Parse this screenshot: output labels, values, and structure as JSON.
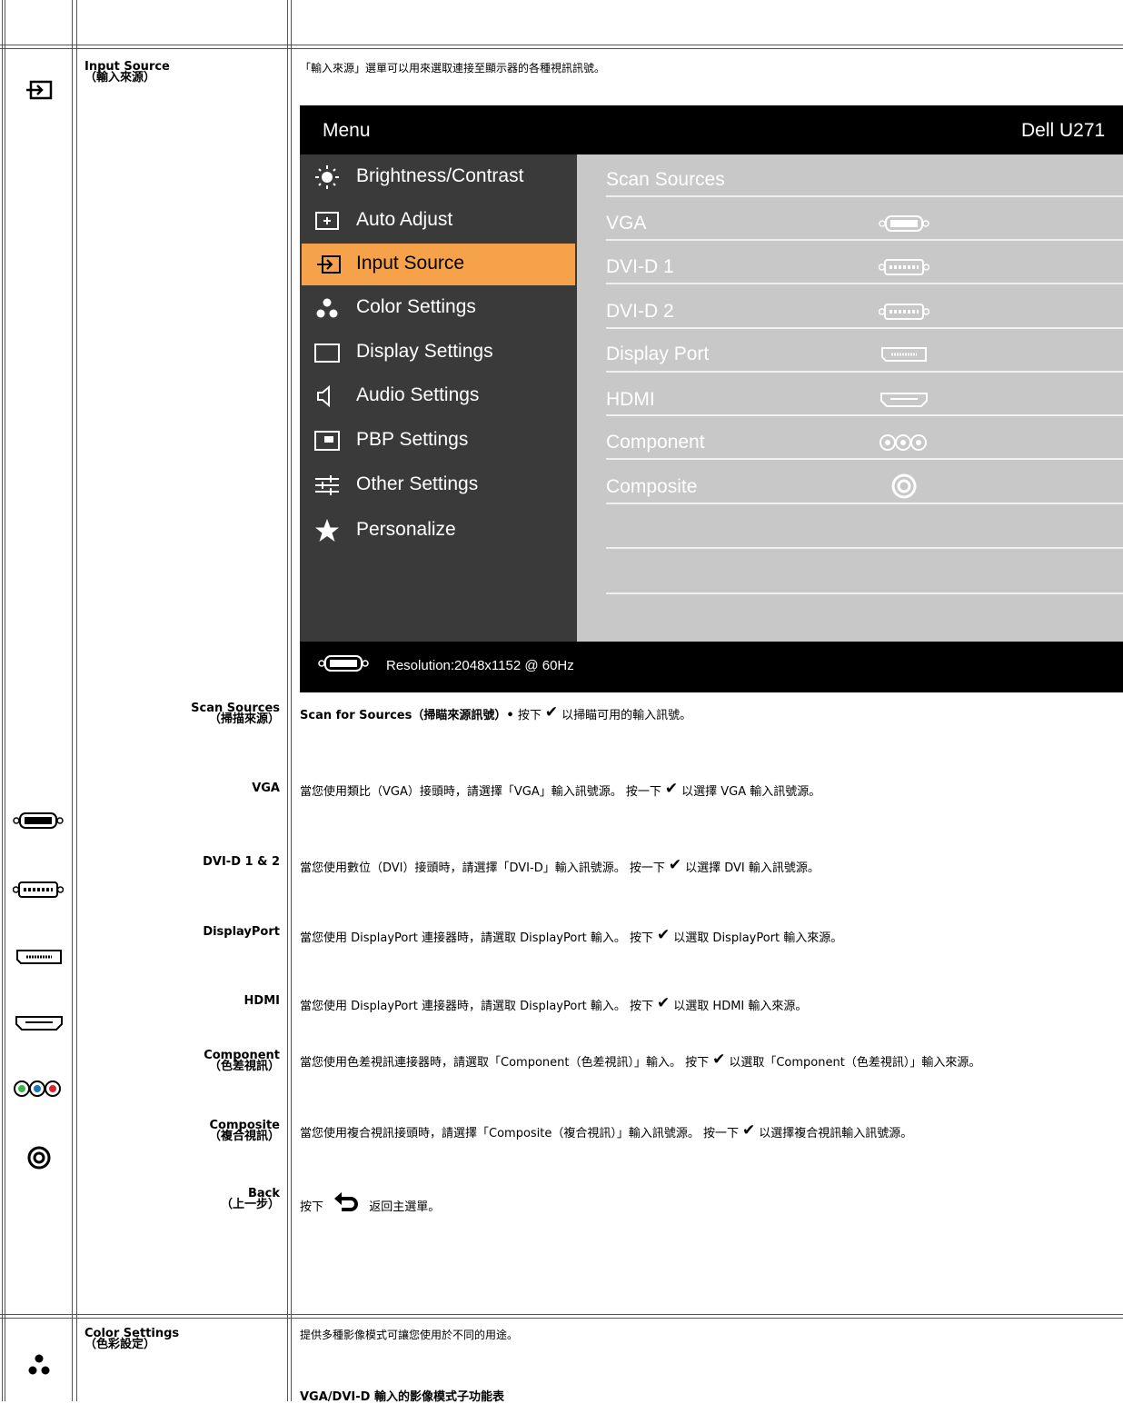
{
  "input_source": {
    "label_en": "Input Source",
    "label_zh": "（輸入來源）",
    "description": "「輸入來源」選單可以用來選取連接至顯示器的各種視訊訊號。"
  },
  "osd": {
    "header_left": "Menu",
    "header_right": "Dell U271",
    "menu_items": [
      {
        "label": "Brightness/Contrast",
        "icon": "brightness-icon"
      },
      {
        "label": "Auto Adjust",
        "icon": "auto-adjust-icon"
      },
      {
        "label": "Input Source",
        "icon": "input-source-icon"
      },
      {
        "label": "Color Settings",
        "icon": "color-settings-icon"
      },
      {
        "label": "Display Settings",
        "icon": "display-settings-icon"
      },
      {
        "label": "Audio Settings",
        "icon": "speaker-icon"
      },
      {
        "label": "PBP Settings",
        "icon": "pbp-icon"
      },
      {
        "label": "Other Settings",
        "icon": "sliders-icon"
      },
      {
        "label": "Personalize",
        "icon": "star-icon"
      }
    ],
    "right_items": [
      {
        "label": "Scan Sources",
        "icon": ""
      },
      {
        "label": "VGA",
        "icon": "vga-connector-icon"
      },
      {
        "label": "DVI-D 1",
        "icon": "dvi-connector-icon"
      },
      {
        "label": "DVI-D 2",
        "icon": "dvi-connector-icon"
      },
      {
        "label": "Display Port",
        "icon": "displayport-connector-icon"
      },
      {
        "label": "HDMI",
        "icon": "hdmi-connector-icon"
      },
      {
        "label": "Component",
        "icon": "component-connector-icon"
      },
      {
        "label": "Composite",
        "icon": "composite-connector-icon"
      }
    ],
    "footer": "Resolution:2048x1152 @ 60Hz",
    "selected_color": "#f5a24a"
  },
  "rows": {
    "scan": {
      "label_en": "Scan Sources",
      "label_zh": "（掃描來源）",
      "bold": "Scan for Sources（掃瞄來源訊號）•",
      "pre": "按下",
      "post": "以掃瞄可用的輸入訊號。"
    },
    "vga": {
      "label": "VGA",
      "pre": "當您使用類比（VGA）接頭時，請選擇「VGA」輸入訊號源。 按一下",
      "post": "以選擇 VGA 輸入訊號源。"
    },
    "dvi": {
      "label": "DVI-D 1 & 2",
      "pre": "當您使用數位（DVI）接頭時，請選擇「DVI-D」輸入訊號源。 按一下",
      "post": "以選擇 DVI 輸入訊號源。"
    },
    "dp": {
      "label": "DisplayPort",
      "pre": "當您使用 DisplayPort 連接器時，請選取 DisplayPort 輸入。 按下",
      "post": "以選取 DisplayPort 輸入來源。"
    },
    "hdmi": {
      "label": "HDMI",
      "pre": "當您使用 DisplayPort 連接器時，請選取 DisplayPort 輸入。 按下",
      "post": "以選取 HDMI 輸入來源。"
    },
    "component": {
      "label_en": "Component",
      "label_zh": "（色差視訊）",
      "pre": "當您使用色差視訊連接器時，請選取「Component（色差視訊）」輸入。 按下",
      "post": "以選取「Component（色差視訊）」輸入來源。"
    },
    "composite": {
      "label_en": "Composite",
      "label_zh": "（複合視訊）",
      "pre": "當您使用複合視訊接頭時，請選擇「Composite（複合視訊）」輸入訊號源。 按一下",
      "post": "以選擇複合視訊輸入訊號源。"
    },
    "back": {
      "label_en": "Back",
      "label_zh": "（上一步）",
      "pre": "按下",
      "post": "返回主選單。"
    }
  },
  "check_glyph": "✔",
  "color_settings": {
    "label_en": "Color Settings",
    "label_zh": "（色彩設定）",
    "description": "提供多種影像模式可讓您使用於不同的用途。",
    "subheading": "VGA/DVI-D 輸入的影像模式子功能表"
  }
}
